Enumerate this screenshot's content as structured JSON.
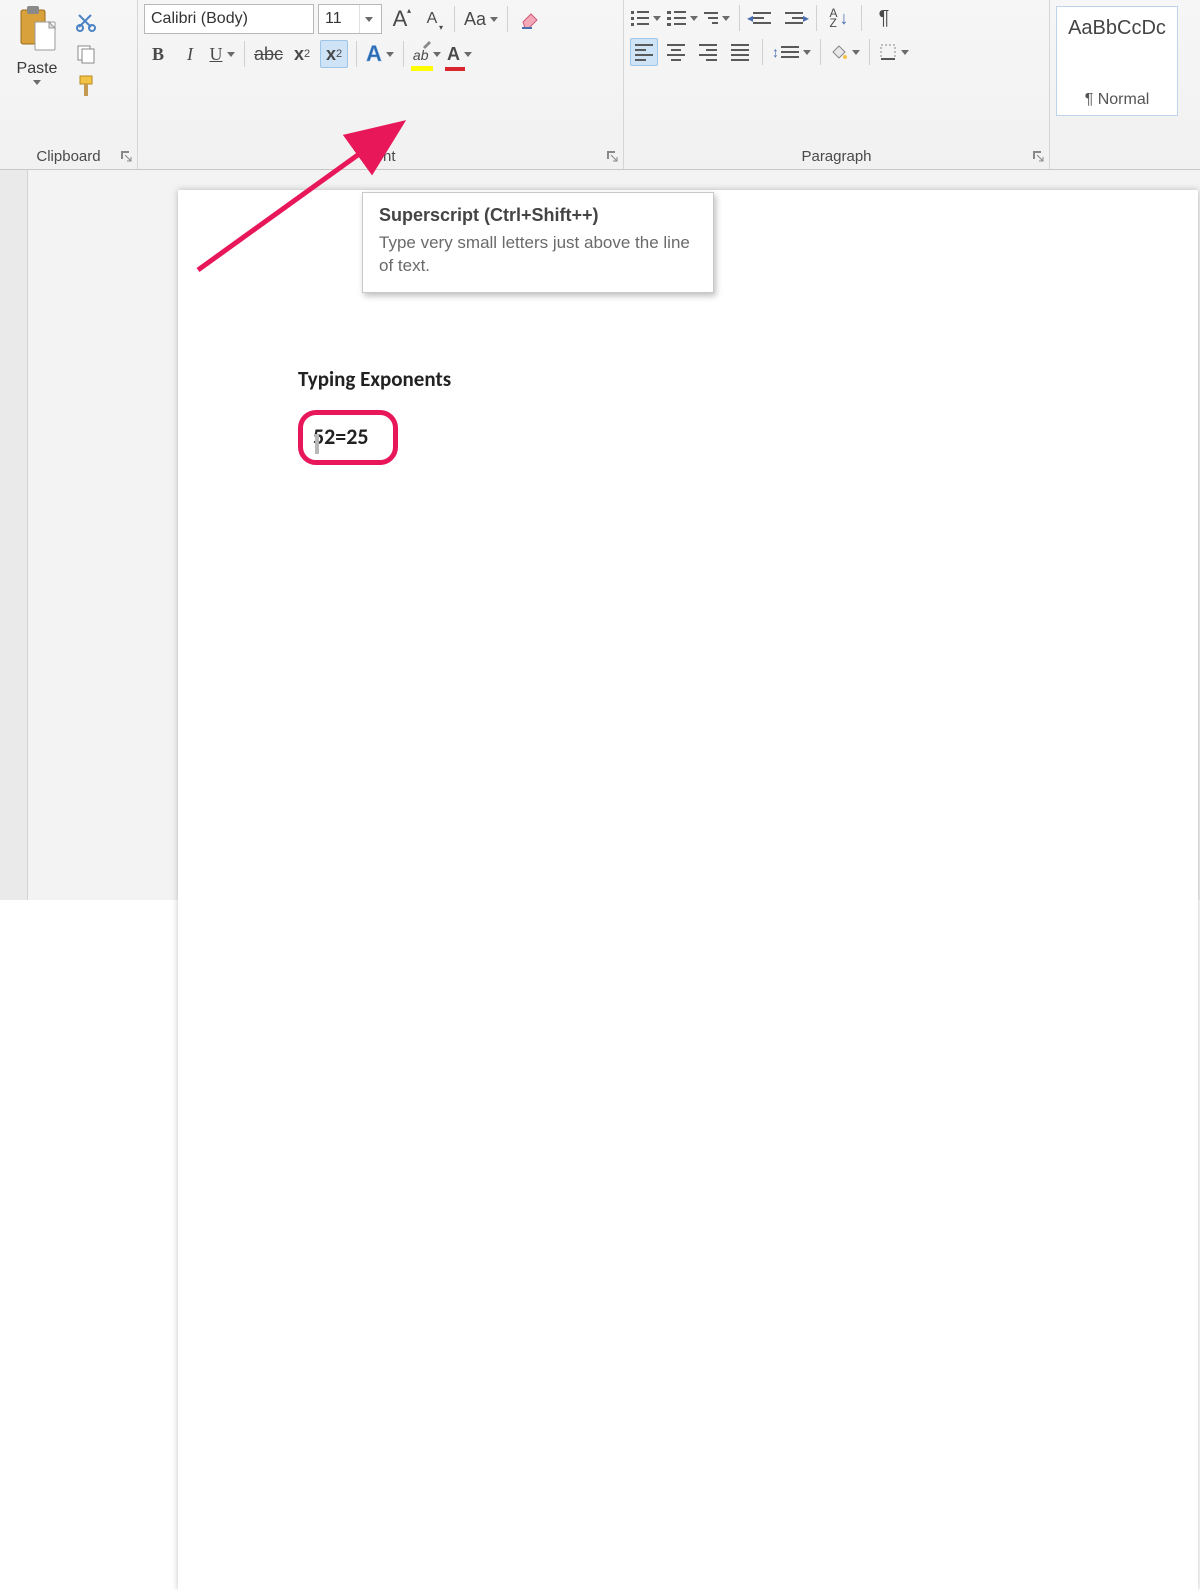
{
  "ribbon": {
    "clipboard": {
      "label": "Clipboard",
      "paste": "Paste"
    },
    "font": {
      "label": "Font",
      "fontname": "Calibri (Body)",
      "fontsize": "11",
      "grow": "A",
      "shrink": "A",
      "changecase": "Aa",
      "bold": "B",
      "italic": "I",
      "underline": "U",
      "strike": "abc",
      "subscript_base": "x",
      "subscript_idx": "2",
      "superscript_base": "x",
      "superscript_idx": "2",
      "texteffects": "A",
      "highlight": "ab",
      "fontcolor": "A"
    },
    "paragraph": {
      "label": "Paragraph",
      "sort": "A",
      "sort2": "Z",
      "showmarks": "¶"
    },
    "styles": {
      "sample": "AaBbCcDc",
      "name": "¶ Normal"
    }
  },
  "tooltip": {
    "title": "Superscript (Ctrl+Shift++)",
    "body": "Type very small letters just above the line of text."
  },
  "doc": {
    "heading": "Typing Exponents",
    "equation": "52=25"
  }
}
